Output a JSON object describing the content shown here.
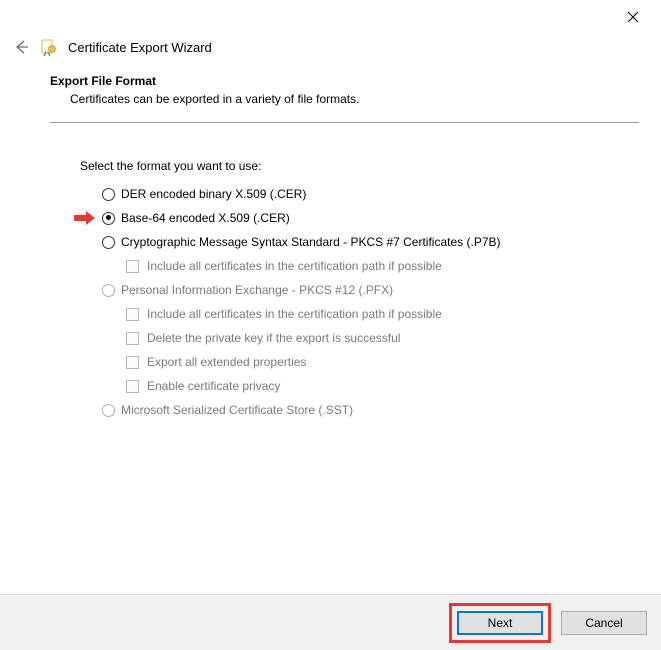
{
  "window": {
    "title": "Certificate Export Wizard"
  },
  "section": {
    "heading": "Export File Format",
    "description": "Certificates can be exported in a variety of file formats."
  },
  "prompt": "Select the format you want to use:",
  "options": {
    "der": "DER encoded binary X.509 (.CER)",
    "base64": "Base-64 encoded X.509 (.CER)",
    "pkcs7": "Cryptographic Message Syntax Standard - PKCS #7 Certificates (.P7B)",
    "pkcs7_include": "Include all certificates in the certification path if possible",
    "pfx": "Personal Information Exchange - PKCS #12 (.PFX)",
    "pfx_include": "Include all certificates in the certification path if possible",
    "pfx_delete": "Delete the private key if the export is successful",
    "pfx_extended": "Export all extended properties",
    "pfx_privacy": "Enable certificate privacy",
    "sst": "Microsoft Serialized Certificate Store (.SST)"
  },
  "buttons": {
    "next": "Next",
    "cancel": "Cancel"
  }
}
